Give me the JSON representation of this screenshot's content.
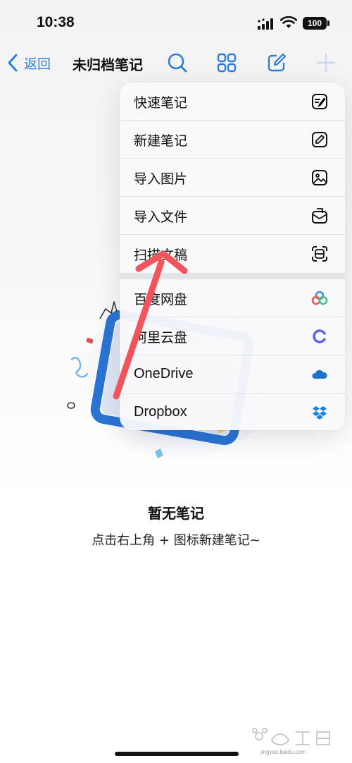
{
  "status_bar": {
    "time": "10:38",
    "battery": "100",
    "icons": [
      "signal-icon",
      "wifi-icon",
      "battery-icon"
    ]
  },
  "nav": {
    "back_label": "返回",
    "title": "未归档笔记",
    "icons": [
      "search-icon",
      "grid-icon",
      "compose-icon",
      "plus-icon"
    ]
  },
  "menu": {
    "primary_items": [
      {
        "label": "快速笔记",
        "icon": "quick-note-icon"
      },
      {
        "label": "新建笔记",
        "icon": "new-note-icon"
      },
      {
        "label": "导入图片",
        "icon": "image-icon"
      },
      {
        "label": "导入文件",
        "icon": "file-import-icon"
      },
      {
        "label": "扫描文稿",
        "icon": "scan-icon"
      }
    ],
    "cloud_items": [
      {
        "label": "百度网盘",
        "icon": "baidu-netdisk-icon"
      },
      {
        "label": "阿里云盘",
        "icon": "aliyun-drive-icon"
      },
      {
        "label": "OneDrive",
        "icon": "onedrive-icon"
      },
      {
        "label": "Dropbox",
        "icon": "dropbox-icon"
      }
    ]
  },
  "empty_state": {
    "title": "暂无笔记",
    "hint": "点击右上角 + 图标新建笔记~"
  },
  "watermark": {
    "text": "jingyan.baidu.com"
  },
  "colors": {
    "accent": "#2a7de1",
    "annotation_arrow": "#f2545b",
    "illustration_blue": "#2a74d6"
  }
}
